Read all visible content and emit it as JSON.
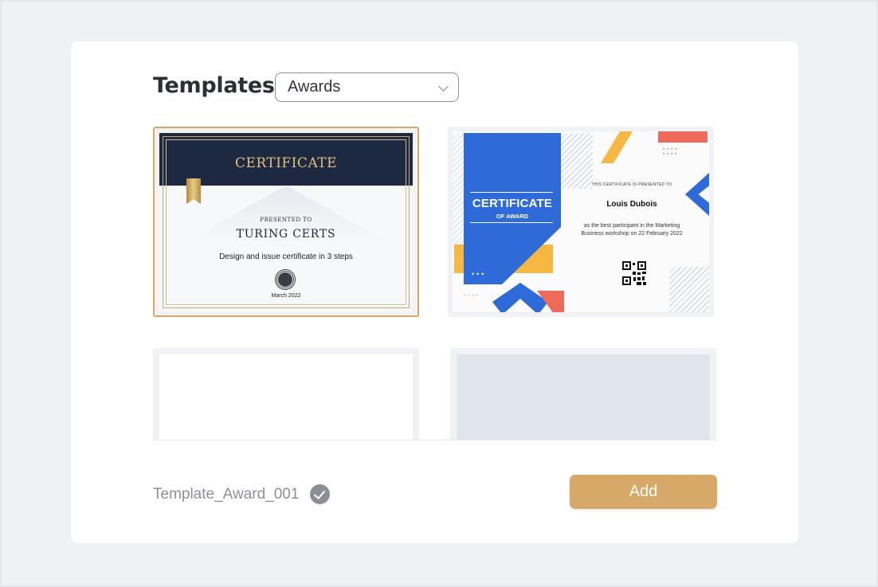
{
  "header": {
    "title": "Templates",
    "category_select": {
      "value": "Awards"
    }
  },
  "templates": [
    {
      "id_label": "certificate-classic",
      "selected": true,
      "title": "CERTIFICATE",
      "presented_to": "PRESENTED TO",
      "name": "TURING CERTS",
      "dots": ".....",
      "description": "Design and issue certificate in 3 steps",
      "date": "March 2022"
    },
    {
      "id_label": "certificate-of-award",
      "selected": false,
      "title": "CERTIFICATE",
      "subtitle": "OF AWARD",
      "presented_to": "THIS CERTIFICATE IS PRESENTED TO",
      "name": "Louis Dubois",
      "description": "as the best participant in the Marketing Business workshop on 22 February 2022"
    }
  ],
  "footer": {
    "template_name": "Template_Award_001",
    "add_button": "Add"
  },
  "colors": {
    "accent": "#d6a968",
    "navy": "#1d2940",
    "blue": "#2f6bd8",
    "yellow": "#f6b843",
    "red": "#f06a5c"
  },
  "icons": [
    "chevron-down-icon",
    "check-circle-icon",
    "seal-icon",
    "qr-code-icon",
    "ribbon-icon"
  ]
}
